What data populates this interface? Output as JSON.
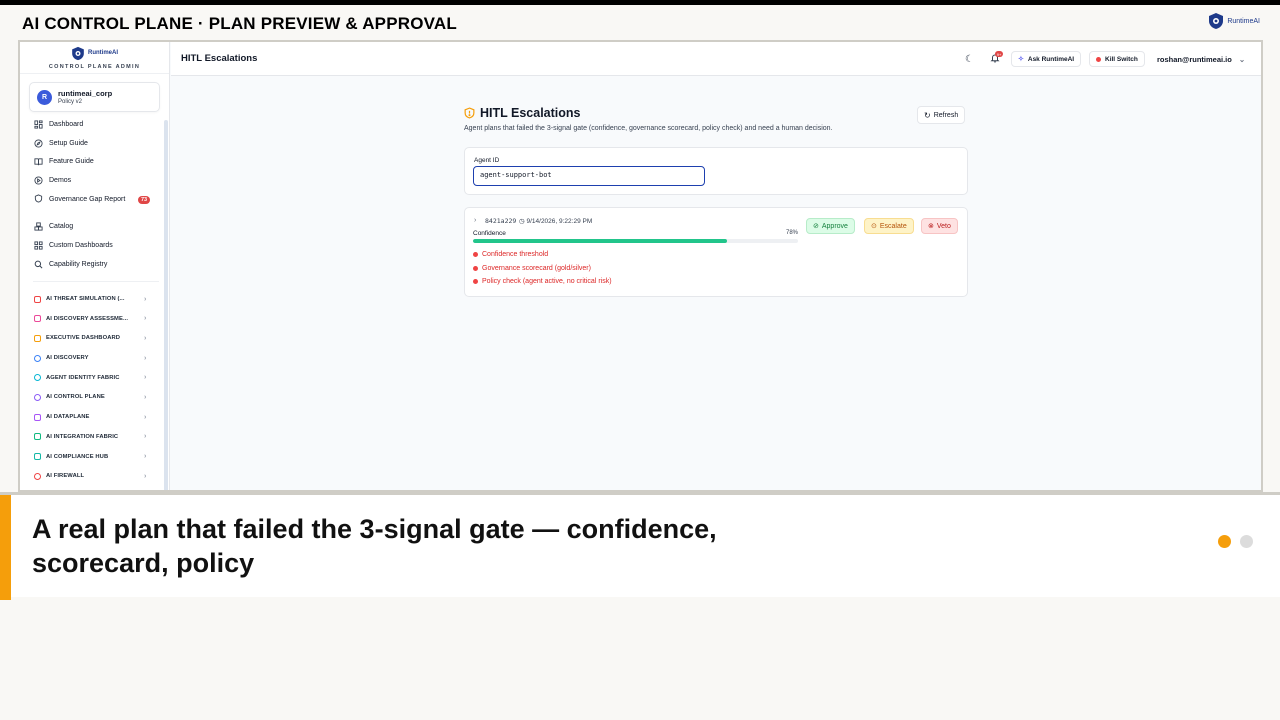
{
  "deck": {
    "title": "AI CONTROL PLANE · PLAN PREVIEW & APPROVAL",
    "logo_text": "RuntimeAI"
  },
  "sidebar": {
    "brand": "RuntimeAI",
    "subtitle": "CONTROL PLANE ADMIN",
    "org": {
      "avatar": "R",
      "name": "runtimeai_corp",
      "policy": "Policy v2"
    },
    "items": [
      {
        "label": "Dashboard",
        "icon": "dashboard-icon"
      },
      {
        "label": "Setup Guide",
        "icon": "compass-icon"
      },
      {
        "label": "Feature Guide",
        "icon": "book-icon"
      },
      {
        "label": "Demos",
        "icon": "play-icon"
      },
      {
        "label": "Governance Gap Report",
        "icon": "shield-icon",
        "badge": "73"
      },
      {
        "label": "Catalog",
        "icon": "boxes-icon"
      },
      {
        "label": "Custom Dashboards",
        "icon": "grid-icon"
      },
      {
        "label": "Capability Registry",
        "icon": "search-icon"
      }
    ],
    "sections": [
      {
        "label": "AI THREAT SIMULATION (...",
        "color": "#ef4444"
      },
      {
        "label": "AI DISCOVERY ASSESSME...",
        "color": "#ec4899"
      },
      {
        "label": "EXECUTIVE DASHBOARD",
        "color": "#f59e0b"
      },
      {
        "label": "AI DISCOVERY",
        "color": "#3b82f6"
      },
      {
        "label": "AGENT IDENTITY FABRIC",
        "color": "#06b6d4"
      },
      {
        "label": "AI CONTROL PLANE",
        "color": "#8b5cf6"
      },
      {
        "label": "AI DATAPLANE",
        "color": "#a855f7"
      },
      {
        "label": "AI INTEGRATION FABRIC",
        "color": "#10b981"
      },
      {
        "label": "AI COMPLIANCE HUB",
        "color": "#14b8a6"
      },
      {
        "label": "AI FIREWALL",
        "color": "#ef4444"
      }
    ]
  },
  "topbar": {
    "title": "HITL Escalations",
    "bell_badge": "9+",
    "ask_label": "Ask RuntimeAI",
    "kill_label": "Kill Switch",
    "user": "roshan@runtimeai.io"
  },
  "page": {
    "title": "HITL Escalations",
    "description": "Agent plans that failed the 3-signal gate (confidence, governance scorecard, policy check) and need a human decision.",
    "refresh_label": "Refresh",
    "agent_label": "Agent ID",
    "agent_value": "agent-support-bot",
    "plan": {
      "id": "8421a229",
      "timestamp": "9/14/2026, 9:22:29 PM",
      "confidence_label": "Confidence",
      "confidence_text": "78%",
      "confidence": 0.78,
      "failures": [
        "Confidence threshold",
        "Governance scorecard (gold/silver)",
        "Policy check (agent active, no critical risk)"
      ],
      "approve_label": "Approve",
      "escalate_label": "Escalate",
      "veto_label": "Veto"
    }
  },
  "caption": {
    "text": "A real plan that failed the 3-signal gate — confidence, scorecard, policy",
    "pager_total": 2,
    "pager_active": 1
  }
}
